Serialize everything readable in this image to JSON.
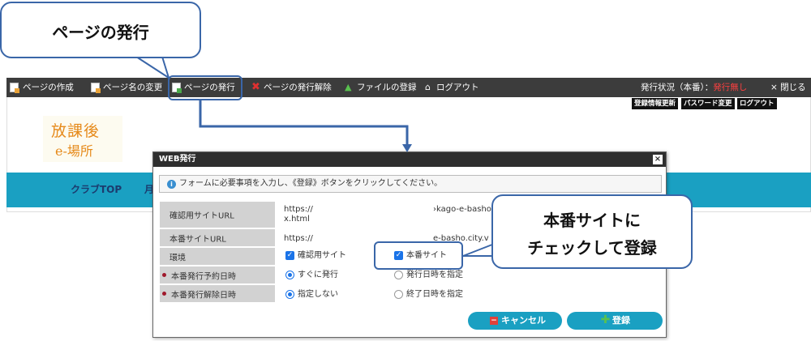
{
  "toolbar": {
    "items": [
      {
        "label": "ページの作成",
        "icon": "page-add-icon"
      },
      {
        "label": "ページ名の変更",
        "icon": "page-edit-icon"
      },
      {
        "label": "ページの発行",
        "icon": "page-publish-icon"
      },
      {
        "label": "ページの発行解除",
        "icon": "unpublish-x-icon"
      },
      {
        "label": "ファイルの登録",
        "icon": "upload-arrow-icon"
      },
      {
        "label": "ログアウト",
        "icon": "home-icon"
      }
    ],
    "status_label": "発行状況（本番）：",
    "status_value": "発行無し",
    "close_label": "× 閉じる"
  },
  "header_buttons": {
    "update_account": "登録情報更新",
    "change_password": "パスワード変更",
    "logout": "ログアウト"
  },
  "site": {
    "logo_line1": "放課後",
    "logo_line2": "e-場所",
    "nav_item1": "クラブTOP",
    "nav_item2": "月"
  },
  "dialog": {
    "title": "WEB発行",
    "close": "×",
    "info": "フォームに必要事項を入力し、《登録》ボタンをクリックしてください。",
    "rows": {
      "check_url": {
        "label": "確認用サイトURL",
        "value_line1": "https://",
        "value_line2": "x.html",
        "value_right": "›kago-e-basho"
      },
      "prod_url": {
        "label": "本番サイトURL",
        "value": "https://",
        "value_right": "e-basho.city.v"
      },
      "environment": {
        "label": "環境",
        "option1": "確認用サイト",
        "option2": "本番サイト"
      },
      "publish_date": {
        "label": "本番発行予約日時",
        "option1": "すぐに発行",
        "option2": "発行日時を指定"
      },
      "unpublish_date": {
        "label": "本番発行解除日時",
        "option1": "指定しない",
        "option2": "終了日時を指定"
      }
    },
    "cancel": "キャンセル",
    "register": "登録"
  },
  "callouts": {
    "publish_page": "ページの発行",
    "check_line1": "本番サイトに",
    "check_line2": "チェックして登録"
  },
  "colors": {
    "toolbar_bg": "#3c3c3c",
    "nav_bg": "#1aa0c2",
    "callout_border": "#3a66a8",
    "required_dot": "#a0192c",
    "status_red": "#ff4040"
  }
}
